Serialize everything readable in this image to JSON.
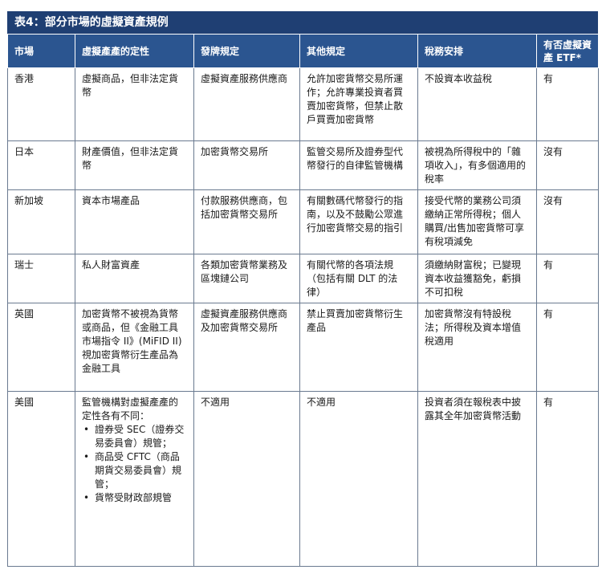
{
  "title": "表4：部分市場的虛擬資產規例",
  "columns": [
    "市場",
    "虛擬產產的定性",
    "發牌規定",
    "其他規定",
    "稅務安排",
    "有否虛擬資產 ETF*"
  ],
  "rows": [
    {
      "market": "香港",
      "definition": "虛擬商品，但非法定貨幣",
      "licensing": "虛擬資產服務供應商",
      "other": "允許加密貨幣交易所運作；允許專業投資者買賣加密貨幣，但禁止散戶買賣加密貨幣",
      "tax": "不設資本收益稅",
      "etf": "有"
    },
    {
      "market": "日本",
      "definition": "財產價值，但非法定貨幣",
      "licensing": "加密貨幣交易所",
      "other": "監管交易所及證券型代幣發行的自律監管機構",
      "tax": "被視為所得稅中的「雜項收入」，有多個適用的稅率",
      "etf": "沒有"
    },
    {
      "market": "新加坡",
      "definition": "資本市場產品",
      "licensing": "付款服務供應商，包括加密貨幣交易所",
      "other": "有關數碼代幣發行的指南，以及不鼓勵公眾進行加密貨幣交易的指引",
      "tax": "接受代幣的業務公司須繳納正常所得稅；個人購買/出售加密貨幣可享有稅項減免",
      "etf": "沒有"
    },
    {
      "market": "瑞士",
      "definition": "私人財富資產",
      "licensing": "各類加密貨幣業務及區塊鏈公司",
      "other": "有關代幣的各項法規（包括有關 DLT 的法律）",
      "tax": "須繳納財富稅；已變現資本收益獲豁免，虧損不可扣稅",
      "etf": "有"
    },
    {
      "market": "英國",
      "definition": "加密貨幣不被視為貨幣或商品，但《金融工具市場指令 II》(MiFID II)視加密貨幣衍生產品為金融工具",
      "licensing": "虛擬資產服務供應商及加密貨幣交易所",
      "other": "禁止買賣加密貨幣衍生產品",
      "tax": "加密貨幣沒有特設稅法；所得稅及資本增值稅適用",
      "etf": "有"
    },
    {
      "market": "美國",
      "definition_intro": "監管機構對虛擬產產的定性各有不同：",
      "definition_bullets": [
        "證券受 SEC（證券交易委員會）規管；",
        "商品受 CFTC（商品期貨交易委員會）規管；",
        "貨幣受財政部規管"
      ],
      "bullet_symbol": "•",
      "licensing": "不適用",
      "other": "不適用",
      "tax": "投資者須在報稅表中披露其全年加密貨幣活動",
      "etf": "有"
    }
  ]
}
